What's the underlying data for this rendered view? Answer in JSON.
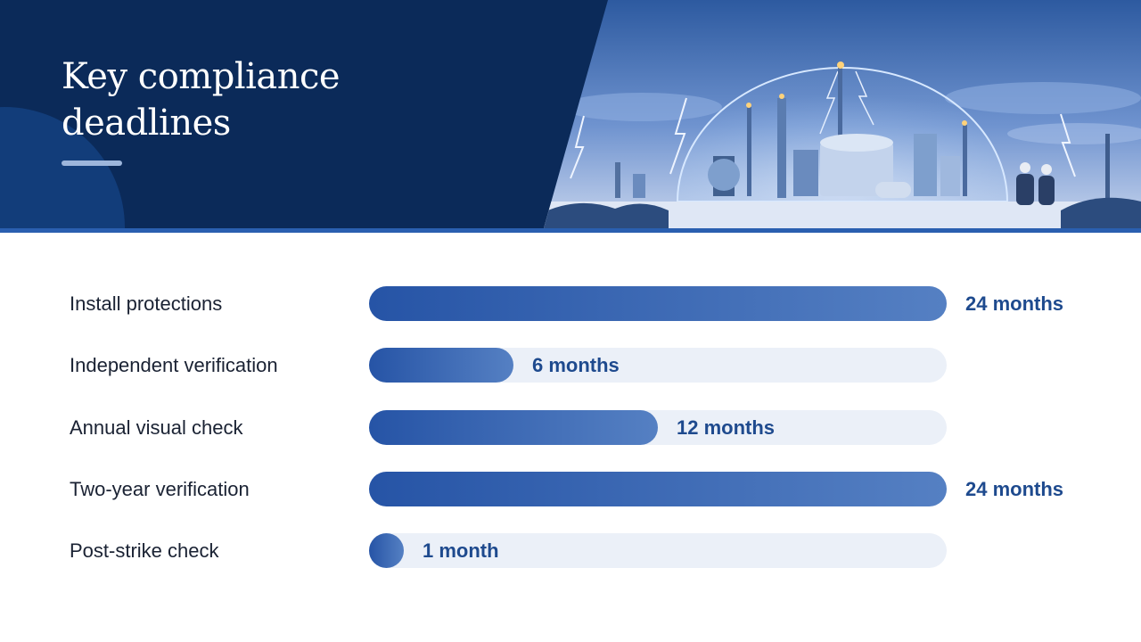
{
  "slide": {
    "title": "Key compliance deadlines"
  },
  "hero_image": {
    "icon": "industrial-plant-lightning-dome-illustration"
  },
  "colors": {
    "header_bg": "#0b2a59",
    "accent": "#2a5fb0",
    "bar_start": "#2654a6",
    "bar_end": "#5580c3",
    "track": "#ebf0f8",
    "value_text": "#1e4a8e",
    "label_text": "#1a2233"
  },
  "chart_data": {
    "type": "bar",
    "orientation": "horizontal",
    "categories": [
      "Install protections",
      "Independent verification",
      "Annual visual check",
      "Two-year verification",
      "Post-strike check"
    ],
    "values": [
      24,
      6,
      12,
      24,
      1
    ],
    "value_labels": [
      "24 months",
      "6 months",
      "12 months",
      "24 months",
      "1 month"
    ],
    "xlim": [
      0,
      24
    ],
    "grid": false
  }
}
